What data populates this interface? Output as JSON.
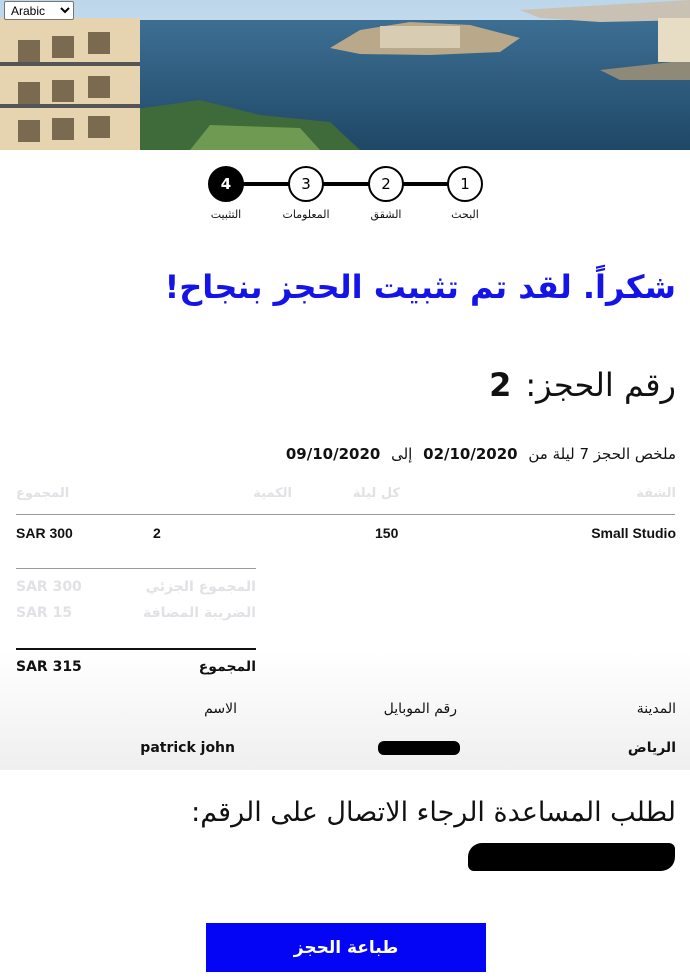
{
  "language": {
    "selected": "Arabic"
  },
  "stepper": {
    "steps": [
      {
        "number": "1",
        "label": "البحث"
      },
      {
        "number": "2",
        "label": "الشقق"
      },
      {
        "number": "3",
        "label": "المعلومات"
      },
      {
        "number": "4",
        "label": "التثبيت"
      }
    ]
  },
  "confirmation": {
    "title": "شكراً. لقد تم تثبيت الحجز بنجاح!",
    "booking_label": "رقم الحجز:",
    "booking_number": "2",
    "summary_prefix": "ملخص الحجز 7 ليلة من",
    "date_from": "02/10/2020",
    "to_word": "إلى",
    "date_to": "09/10/2020"
  },
  "table": {
    "headers": {
      "apartment": "الشقة",
      "per_night": "كل ليلة",
      "quantity": "الكمية",
      "total": "المجموع"
    },
    "row": {
      "apartment": "Small Studio",
      "per_night": "150",
      "quantity": "2",
      "total": "SAR 300"
    }
  },
  "totals": {
    "subtotal_label": "المجموع الجزئي",
    "subtotal_value": "SAR 300",
    "vat_label": "الضريبة المضافة",
    "vat_value": "SAR 15",
    "total_label": "المجموع",
    "total_value": "SAR 315"
  },
  "guest": {
    "city_label": "المدينة",
    "mobile_label": "رقم الموبايل",
    "name_label": "الاسم",
    "city_value": "الرياض",
    "name_value": "patrick john"
  },
  "help_text": "لطلب المساعدة الرجاء الاتصال على الرقم:",
  "print_button": "طباعة الحجز",
  "colors": {
    "accent": "#0505f5",
    "title": "#1414e8"
  }
}
